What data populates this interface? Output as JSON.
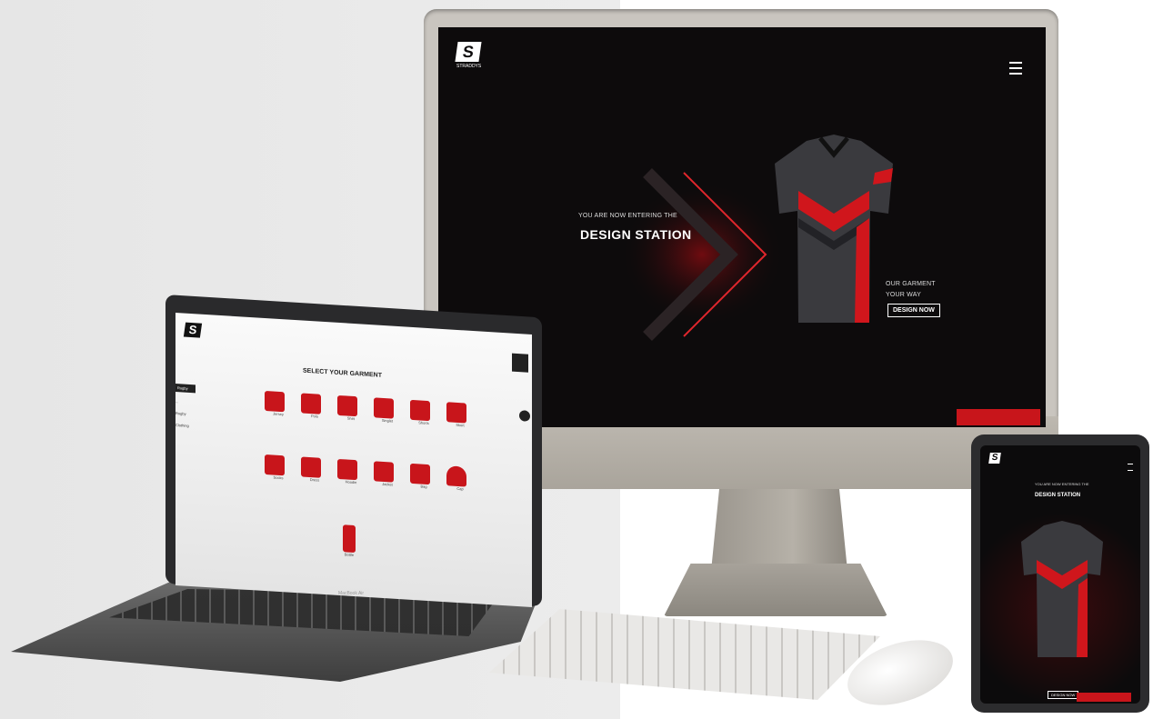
{
  "monitor": {
    "logo_letter": "S",
    "logo_text": "STRADDYS",
    "tagline": "YOU ARE NOW ENTERING THE",
    "headline": "DESIGN STATION",
    "side_text_1": "OUR GARMENT",
    "side_text_2": "YOUR WAY",
    "design_button": "DESIGN NOW"
  },
  "laptop": {
    "logo_letter": "S",
    "heading": "SELECT YOUR GARMENT",
    "sidebar": [
      "Rugby",
      "...",
      "Rugby",
      "Clothing"
    ],
    "garments_row1": [
      "Jersey",
      "Polo",
      "Shirt",
      "Singlet",
      "Shorts",
      "Skort"
    ],
    "garments_row2": [
      "Socks",
      "Dress",
      "Hoodie",
      "Jacket",
      "Bag",
      "Cap"
    ],
    "garments_row3": [
      "Bottle"
    ],
    "brand": "MacBook Air"
  },
  "tablet": {
    "logo_letter": "S",
    "tagline": "YOU ARE NOW ENTERING THE",
    "headline": "DESIGN STATION",
    "design_button": "DESIGN NOW"
  },
  "colors": {
    "accent": "#c8151b",
    "screen_dark": "#0d0b0c"
  }
}
